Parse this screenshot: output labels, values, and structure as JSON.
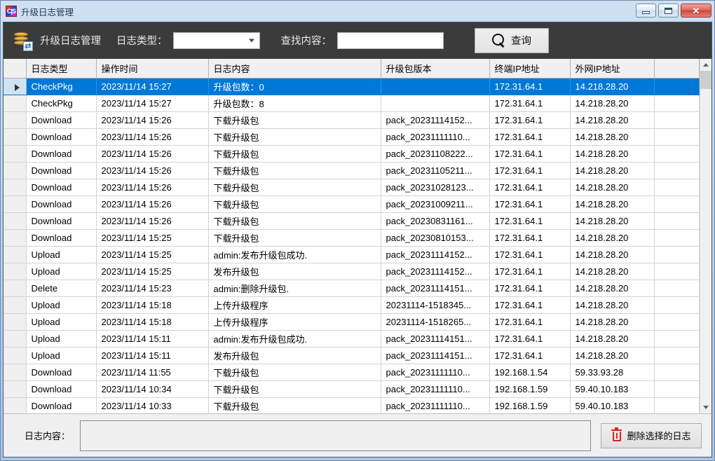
{
  "window": {
    "title": "升级日志管理",
    "title_icon": "cis-app-icon",
    "buttons": {
      "minimize": "minimize-button",
      "maximize": "maximize-button",
      "close": "close-button"
    }
  },
  "toolbar": {
    "app_icon": "coins-database-icon",
    "module_title": "升级日志管理",
    "log_type_label": "日志类型：",
    "log_type_value": "",
    "log_type_options": [
      ""
    ],
    "search_label": "查找内容：",
    "search_value": "",
    "search_placeholder": "",
    "query_button": "查询",
    "query_icon": "search-icon"
  },
  "grid": {
    "columns": [
      {
        "key": "selector",
        "label": ""
      },
      {
        "key": "type",
        "label": "日志类型"
      },
      {
        "key": "time",
        "label": "操作时间"
      },
      {
        "key": "content",
        "label": "日志内容"
      },
      {
        "key": "version",
        "label": "升级包版本"
      },
      {
        "key": "terminal_ip",
        "label": "终端IP地址"
      },
      {
        "key": "wan_ip",
        "label": "外网IP地址"
      }
    ],
    "rows": [
      {
        "type": "CheckPkg",
        "time": "2023/11/14 15:27",
        "content": "升级包数：0",
        "version": "",
        "terminal_ip": "172.31.64.1",
        "wan_ip": "14.218.28.20",
        "selected": true
      },
      {
        "type": "CheckPkg",
        "time": "2023/11/14 15:27",
        "content": "升级包数：8",
        "version": "",
        "terminal_ip": "172.31.64.1",
        "wan_ip": "14.218.28.20",
        "selected": false
      },
      {
        "type": "Download",
        "time": "2023/11/14 15:26",
        "content": "下载升级包",
        "version": "pack_20231114152...",
        "terminal_ip": "172.31.64.1",
        "wan_ip": "14.218.28.20",
        "selected": false
      },
      {
        "type": "Download",
        "time": "2023/11/14 15:26",
        "content": "下载升级包",
        "version": "pack_20231111110...",
        "terminal_ip": "172.31.64.1",
        "wan_ip": "14.218.28.20",
        "selected": false
      },
      {
        "type": "Download",
        "time": "2023/11/14 15:26",
        "content": "下载升级包",
        "version": "pack_20231108222...",
        "terminal_ip": "172.31.64.1",
        "wan_ip": "14.218.28.20",
        "selected": false
      },
      {
        "type": "Download",
        "time": "2023/11/14 15:26",
        "content": "下载升级包",
        "version": "pack_20231105211...",
        "terminal_ip": "172.31.64.1",
        "wan_ip": "14.218.28.20",
        "selected": false
      },
      {
        "type": "Download",
        "time": "2023/11/14 15:26",
        "content": "下载升级包",
        "version": "pack_20231028123...",
        "terminal_ip": "172.31.64.1",
        "wan_ip": "14.218.28.20",
        "selected": false
      },
      {
        "type": "Download",
        "time": "2023/11/14 15:26",
        "content": "下载升级包",
        "version": "pack_20231009211...",
        "terminal_ip": "172.31.64.1",
        "wan_ip": "14.218.28.20",
        "selected": false
      },
      {
        "type": "Download",
        "time": "2023/11/14 15:26",
        "content": "下载升级包",
        "version": "pack_20230831161...",
        "terminal_ip": "172.31.64.1",
        "wan_ip": "14.218.28.20",
        "selected": false
      },
      {
        "type": "Download",
        "time": "2023/11/14 15:25",
        "content": "下载升级包",
        "version": "pack_20230810153...",
        "terminal_ip": "172.31.64.1",
        "wan_ip": "14.218.28.20",
        "selected": false
      },
      {
        "type": "Upload",
        "time": "2023/11/14 15:25",
        "content": "admin:发布升级包成功.",
        "version": "pack_20231114152...",
        "terminal_ip": "172.31.64.1",
        "wan_ip": "14.218.28.20",
        "selected": false
      },
      {
        "type": "Upload",
        "time": "2023/11/14 15:25",
        "content": "发布升级包",
        "version": "pack_20231114152...",
        "terminal_ip": "172.31.64.1",
        "wan_ip": "14.218.28.20",
        "selected": false
      },
      {
        "type": "Delete",
        "time": "2023/11/14 15:23",
        "content": "admin:删除升级包.",
        "version": "pack_20231114151...",
        "terminal_ip": "172.31.64.1",
        "wan_ip": "14.218.28.20",
        "selected": false
      },
      {
        "type": "Upload",
        "time": "2023/11/14 15:18",
        "content": "上传升级程序",
        "version": "20231114-1518345...",
        "terminal_ip": "172.31.64.1",
        "wan_ip": "14.218.28.20",
        "selected": false
      },
      {
        "type": "Upload",
        "time": "2023/11/14 15:18",
        "content": "上传升级程序",
        "version": "20231114-1518265...",
        "terminal_ip": "172.31.64.1",
        "wan_ip": "14.218.28.20",
        "selected": false
      },
      {
        "type": "Upload",
        "time": "2023/11/14 15:11",
        "content": "admin:发布升级包成功.",
        "version": "pack_20231114151...",
        "terminal_ip": "172.31.64.1",
        "wan_ip": "14.218.28.20",
        "selected": false
      },
      {
        "type": "Upload",
        "time": "2023/11/14 15:11",
        "content": "发布升级包",
        "version": "pack_20231114151...",
        "terminal_ip": "172.31.64.1",
        "wan_ip": "14.218.28.20",
        "selected": false
      },
      {
        "type": "Download",
        "time": "2023/11/14 11:55",
        "content": "下载升级包",
        "version": "pack_20231111110...",
        "terminal_ip": "192.168.1.54",
        "wan_ip": "59.33.93.28",
        "selected": false
      },
      {
        "type": "Download",
        "time": "2023/11/14 10:34",
        "content": "下载升级包",
        "version": "pack_20231111110...",
        "terminal_ip": "192.168.1.59",
        "wan_ip": "59.40.10.183",
        "selected": false
      },
      {
        "type": "Download",
        "time": "2023/11/14 10:33",
        "content": "下载升级包",
        "version": "pack_20231111110...",
        "terminal_ip": "192.168.1.59",
        "wan_ip": "59.40.10.183",
        "selected": false
      }
    ],
    "selected_row_marker": "▶",
    "scrollbar": {
      "up_icon": "chevron-up-icon",
      "down_icon": "chevron-down-icon"
    }
  },
  "bottom": {
    "log_content_label": "日志内容：",
    "log_content_value": "",
    "delete_button": "删除选择的日志",
    "delete_icon": "trash-icon"
  },
  "colors": {
    "selection": "#0078d7",
    "toolbar_bg": "#3b3b3b",
    "title_gradient_top": "#cfe0f2",
    "delete_icon": "#d6271f"
  }
}
